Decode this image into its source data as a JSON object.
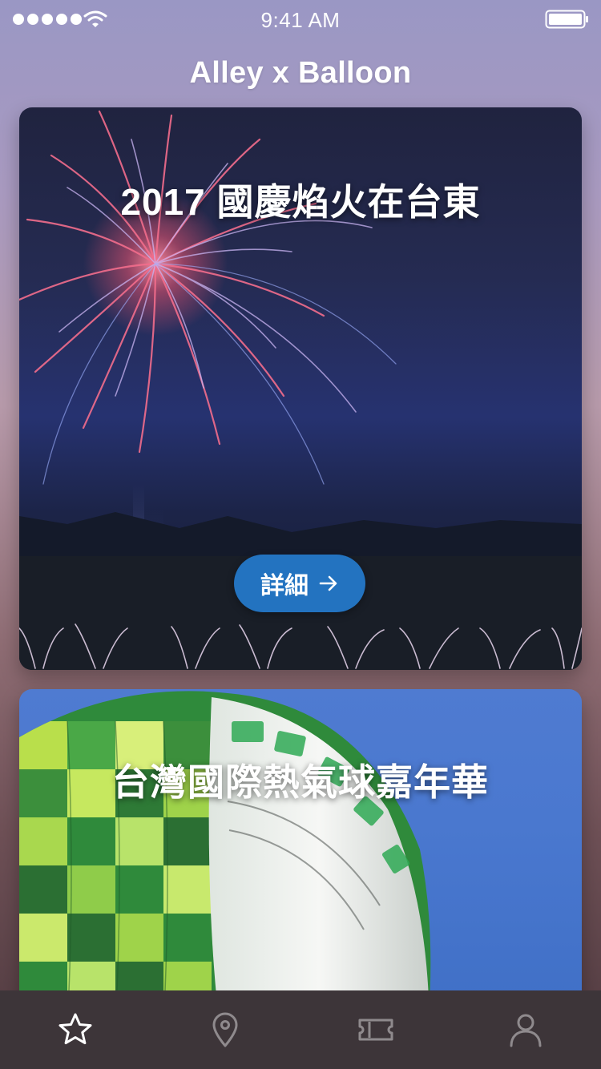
{
  "status_bar": {
    "time": "9:41 AM",
    "signal_icon": "signal-dots-icon",
    "wifi_icon": "wifi-icon",
    "battery_icon": "battery-icon"
  },
  "header": {
    "title": "Alley x Balloon"
  },
  "cards": [
    {
      "title": "2017 國慶焰火在台東",
      "button_label": "詳細",
      "button_icon": "arrow-right-icon",
      "image": "fireworks-photo"
    },
    {
      "title": "台灣國際熱氣球嘉年華",
      "image": "hot-air-balloon-photo"
    }
  ],
  "tab_bar": {
    "tabs": [
      {
        "icon": "star-icon",
        "active": true
      },
      {
        "icon": "map-pin-icon",
        "active": false
      },
      {
        "icon": "ticket-icon",
        "active": false
      },
      {
        "icon": "user-icon",
        "active": false
      }
    ]
  },
  "colors": {
    "accent": "#2373c0",
    "tab_bar_bg": "#3d3539",
    "tab_active": "#ffffff",
    "tab_inactive": "#8f8a8d"
  }
}
